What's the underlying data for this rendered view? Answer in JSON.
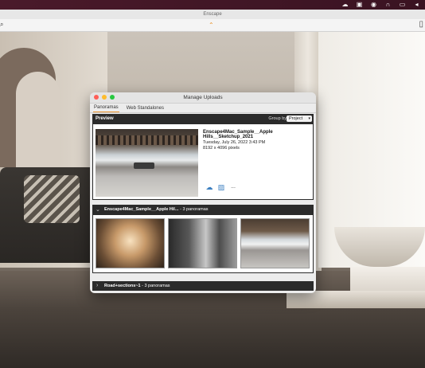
{
  "app": {
    "title": "Enscape"
  },
  "menubar": {
    "icons": [
      "cloud-icon",
      "app-icon",
      "record-icon",
      "headphones-icon",
      "display-icon",
      "volume-icon"
    ]
  },
  "dialog": {
    "title": "Manage Uploads",
    "tabs": [
      {
        "label": "Panoramas",
        "active": true
      },
      {
        "label": "Web Standalones",
        "active": false
      }
    ],
    "preview": {
      "label": "Preview",
      "group_by_label": "Group by",
      "group_by_value": "Project",
      "name": "Enscape4Mac_Sample__Apple Hills__Sketchup_2021",
      "date": "Tuesday, July 26, 2022 3:43 PM",
      "size": "8192 x 4096 pixels",
      "more": "..."
    },
    "groups": [
      {
        "name": "Enscape4Mac_Sample__Apple Hil...",
        "count": "- 3 panoramas",
        "expanded": true
      },
      {
        "name": "Road+sections~1",
        "count": "- 3 panoramas",
        "expanded": false
      }
    ]
  },
  "colors": {
    "accent": "#e8922a",
    "dark_header": "#2b2b2b"
  }
}
